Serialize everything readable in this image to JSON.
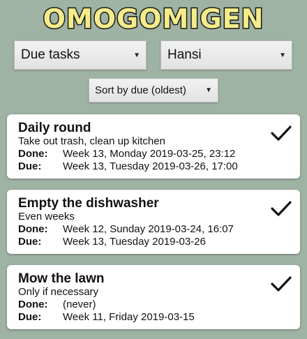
{
  "app": {
    "logo_text": "OMOGOMIGEN"
  },
  "filters": {
    "list_value": "Due tasks",
    "user_value": "Hansi",
    "sort_value": "Sort by due (oldest)"
  },
  "labels": {
    "done": "Done:",
    "due": "Due:"
  },
  "tasks": [
    {
      "title": "Daily round",
      "description": "Take out trash, clean up kitchen",
      "done": "Week 13, Monday 2019-03-25, 23:12",
      "due": "Week 13, Tuesday 2019-03-26, 17:00",
      "check_icon": "checkmark-icon"
    },
    {
      "title": "Empty the dishwasher",
      "description": "Even weeks",
      "done": "Week 12, Sunday 2019-03-24, 16:07",
      "due": "Week 13, Tuesday 2019-03-26",
      "check_icon": "checkmark-icon"
    },
    {
      "title": "Mow the lawn",
      "description": "Only if necessary",
      "done": "(never)",
      "due": "Week 11, Friday 2019-03-15",
      "check_icon": "checkmark-icon"
    }
  ],
  "colors": {
    "background": "#9fb3a4",
    "logo_fill": "#f4ec8a",
    "logo_stroke": "#1a1a1a",
    "card": "#ffffff"
  }
}
